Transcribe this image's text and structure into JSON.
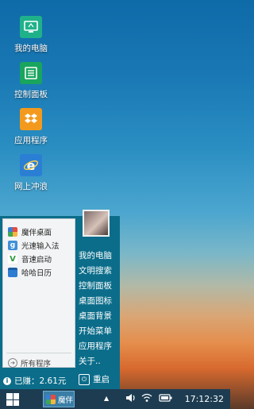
{
  "desktop": {
    "icons": [
      {
        "label": "我的电脑",
        "icon": "computer-icon",
        "color": "#1fb28a"
      },
      {
        "label": "控制面板",
        "icon": "control-panel-icon",
        "color": "#19a55e"
      },
      {
        "label": "应用程序",
        "icon": "dropbox-icon",
        "color": "#f39a1e"
      },
      {
        "label": "网上冲浪",
        "icon": "ie-icon",
        "color": "#2a7fd4"
      }
    ]
  },
  "start_menu": {
    "apps": [
      {
        "label": "魔伴桌面",
        "icon": "mobanzhuomian-icon"
      },
      {
        "label": "光速输入法",
        "icon": "input-method-icon"
      },
      {
        "label": "音速启动",
        "icon": "vstart-icon"
      },
      {
        "label": "哈哈日历",
        "icon": "calendar-icon"
      }
    ],
    "all_programs": "所有程序",
    "right_items": [
      "我的电脑",
      "文明搜索",
      "控制面板",
      "桌面图标",
      "桌面背景",
      "开始菜单",
      "应用程序",
      "关于.."
    ],
    "earned": "已赚：2.61元",
    "restart": "重启"
  },
  "taskbar": {
    "app_label": "魔伴",
    "tray_arrow": "▲",
    "clock": "17:12:32"
  }
}
